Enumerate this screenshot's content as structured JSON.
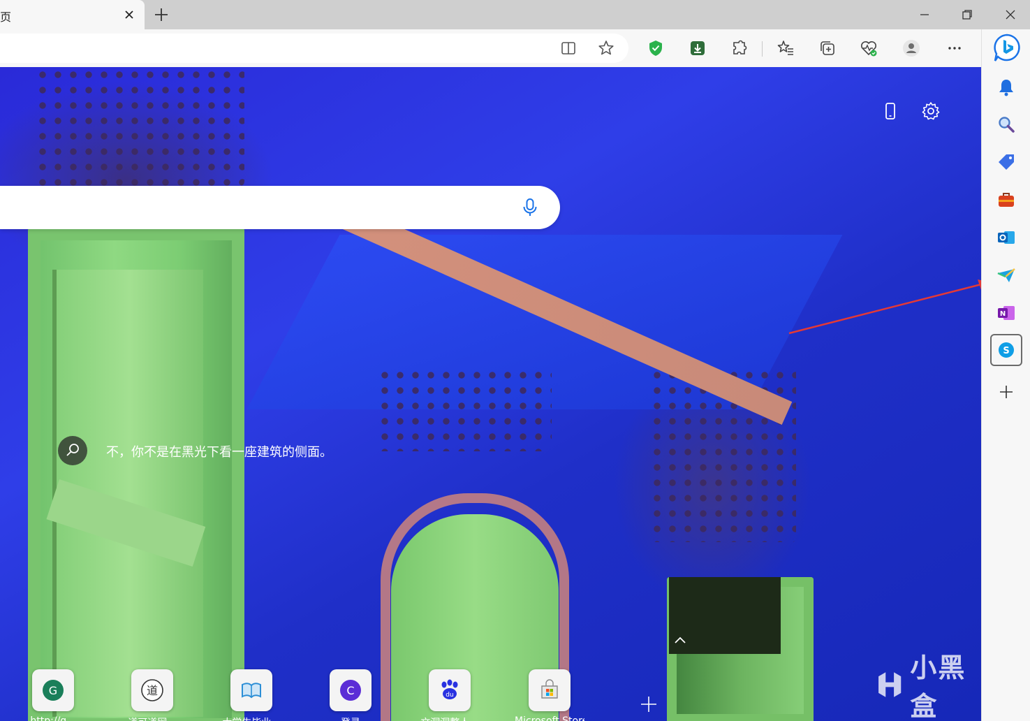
{
  "tab": {
    "title": "页",
    "close_label": "×"
  },
  "window_controls": [
    "minimize",
    "restore",
    "close"
  ],
  "toolbar": {
    "icons": [
      "split-screen-icon",
      "favorite-star-icon",
      "shield-extension-icon",
      "download-extension-icon",
      "extensions-icon",
      "favorites-icon",
      "collections-icon",
      "performance-icon",
      "profile-icon",
      "more-icon"
    ]
  },
  "sidebar": {
    "items": [
      "bing-chat-icon",
      "notification-bell-icon",
      "search-icon",
      "shopping-tag-icon",
      "tools-briefcase-icon",
      "outlook-icon",
      "drop-send-icon",
      "onenote-icon",
      "skype-icon",
      "add-icon"
    ],
    "selected": "skype-icon"
  },
  "search": {
    "placeholder": ""
  },
  "image_caption": {
    "text": "不，你不是在黑光下看一座建筑的侧面。"
  },
  "quick_links": [
    {
      "label": "http://g...",
      "badge": "G",
      "color": "#1a7f5a"
    },
    {
      "label": "道可道网...",
      "badge": "道",
      "color": "#333333"
    },
    {
      "label": "大学生毕业...",
      "badge": "",
      "color": "#2b8ed6"
    },
    {
      "label": "登录",
      "badge": "C",
      "color": "#5b2dd6"
    },
    {
      "label": "文洞洞整人...",
      "badge": "du",
      "color": "#2932e1"
    },
    {
      "label": "Microsoft Store",
      "badge": "",
      "color": "#777777"
    }
  ],
  "watermark": {
    "text": "小黑盒"
  },
  "colors": {
    "accent_blue": "#1a73e8",
    "annotation_red": "#e53935",
    "shield_green": "#2bb24c"
  }
}
